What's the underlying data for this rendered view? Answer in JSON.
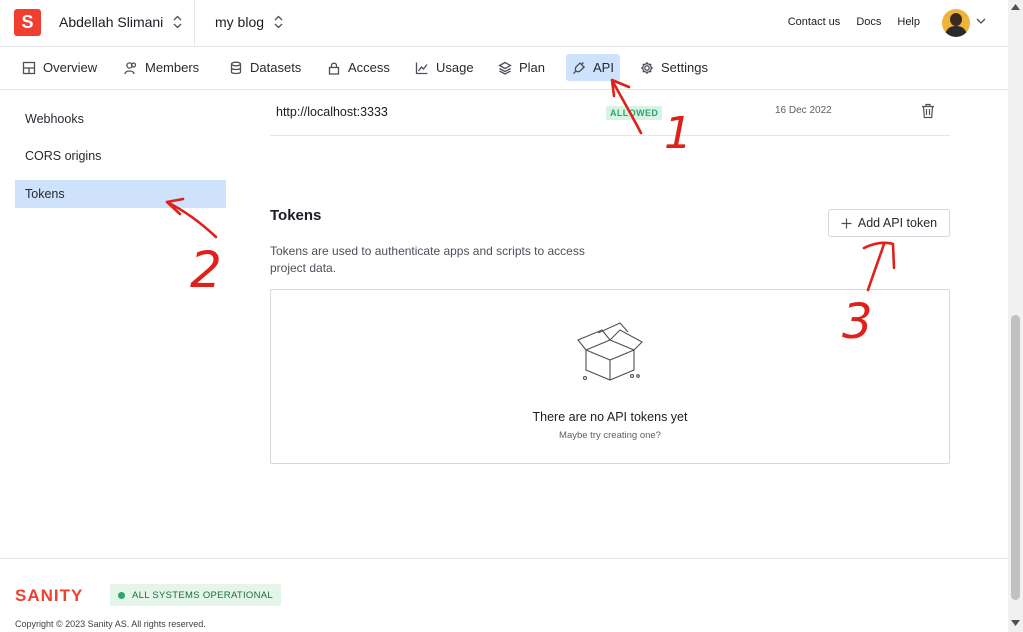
{
  "header": {
    "logo_letter": "S",
    "organization": "Abdellah Slimani",
    "project": "my blog",
    "links": [
      "Contact us",
      "Docs",
      "Help"
    ]
  },
  "nav": {
    "tabs": [
      {
        "label": "Overview",
        "icon": "grid-icon"
      },
      {
        "label": "Members",
        "icon": "users-icon"
      },
      {
        "label": "Datasets",
        "icon": "database-icon"
      },
      {
        "label": "Access",
        "icon": "lock-icon"
      },
      {
        "label": "Usage",
        "icon": "chart-icon"
      },
      {
        "label": "Plan",
        "icon": "layers-icon"
      },
      {
        "label": "API",
        "icon": "plug-icon",
        "active": true
      },
      {
        "label": "Settings",
        "icon": "gear-icon"
      }
    ]
  },
  "sidebar": {
    "items": [
      {
        "label": "Webhooks"
      },
      {
        "label": "CORS origins"
      },
      {
        "label": "Tokens",
        "active": true
      }
    ]
  },
  "cors": {
    "origin": "http://localhost:3333",
    "status": "ALLOWED",
    "date": "16 Dec 2022"
  },
  "tokens": {
    "title": "Tokens",
    "add_button": "Add API token",
    "description": "Tokens are used to authenticate apps and scripts to access project data.",
    "empty_title": "There are no API tokens yet",
    "empty_subtitle": "Maybe try creating one?"
  },
  "footer": {
    "brand": "SANITY",
    "status": "ALL SYSTEMS OPERATIONAL",
    "copyright": "Copyright © 2023 Sanity AS. All rights reserved."
  },
  "annotations": [
    "1",
    "2",
    "3"
  ],
  "colors": {
    "brand": "#f03e2f",
    "active_bg": "#cfe2fb",
    "ok_green": "#30a46c",
    "annotation_red": "#e0201b"
  }
}
